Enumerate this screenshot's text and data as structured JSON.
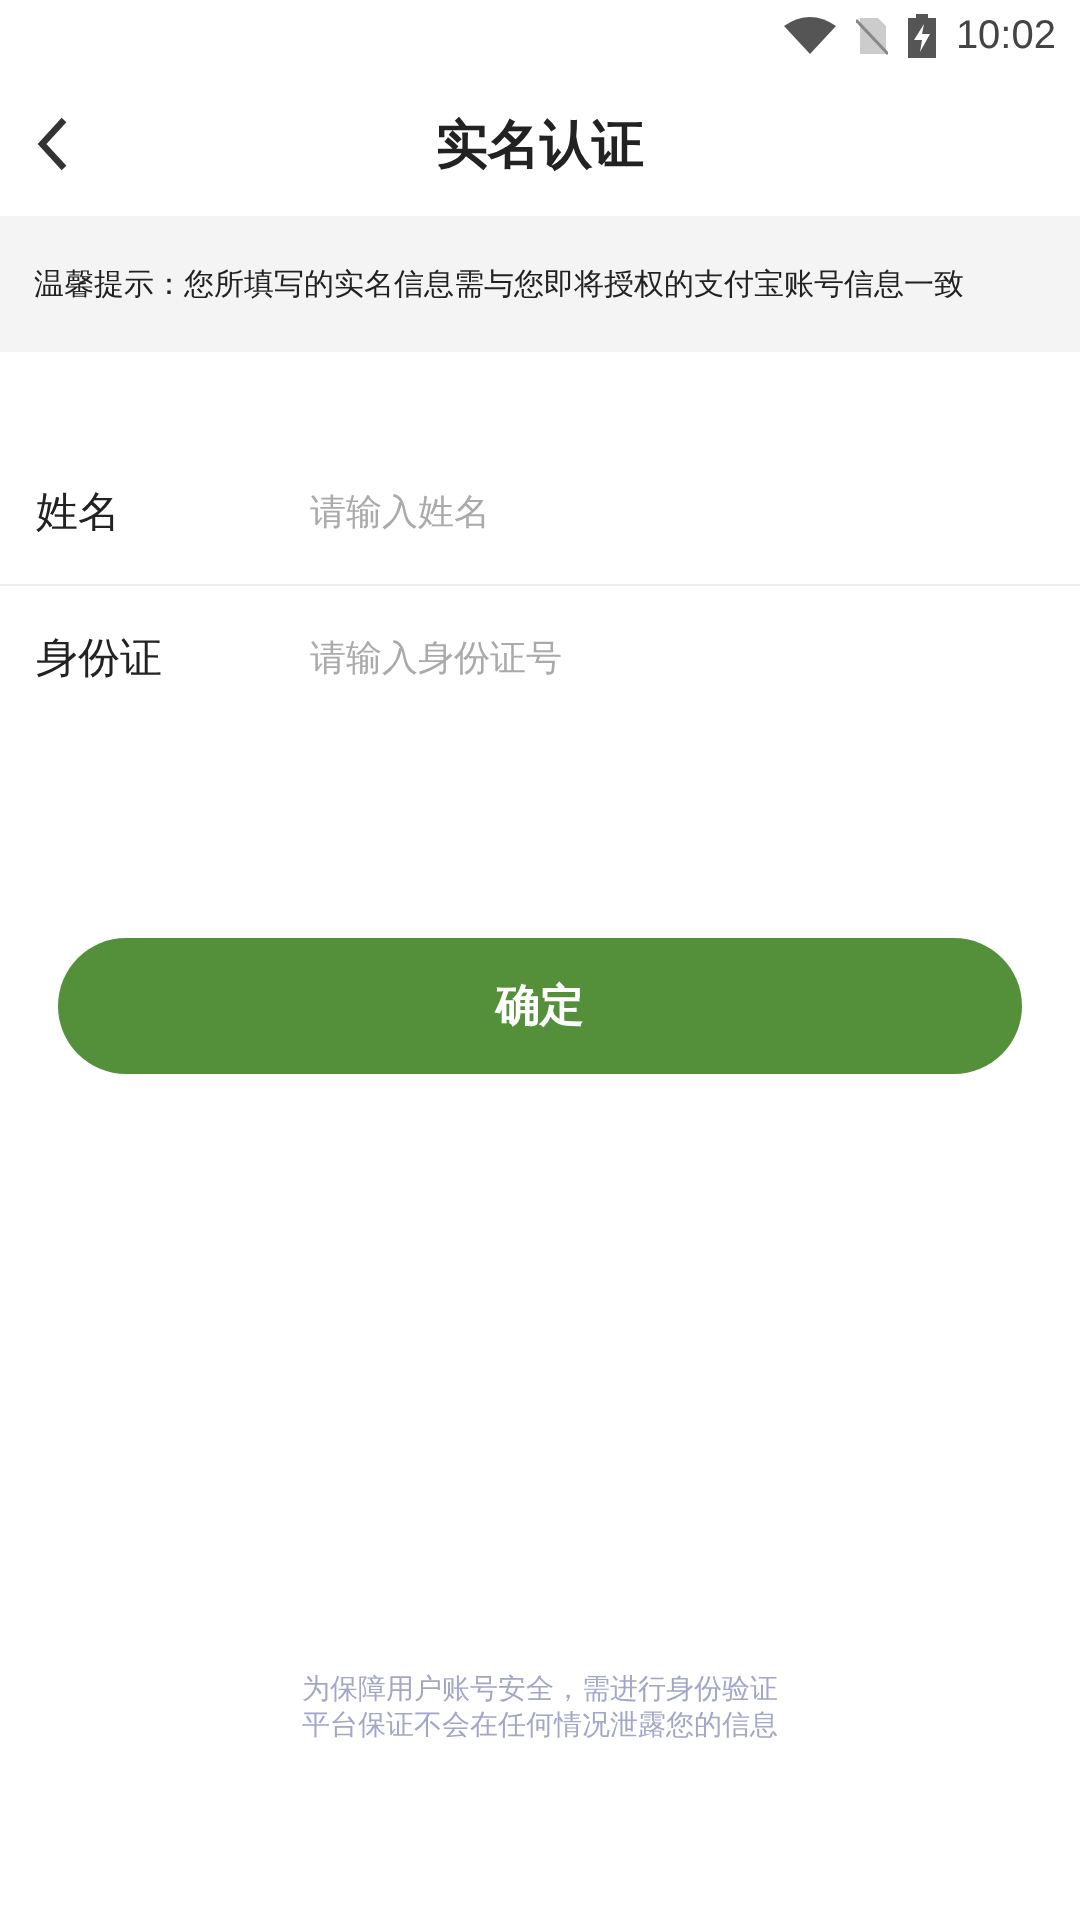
{
  "status_bar": {
    "time": "10:02"
  },
  "header": {
    "title": "实名认证"
  },
  "notice": "温馨提示：您所填写的实名信息需与您即将授权的支付宝账号信息一致",
  "fields": [
    {
      "label": "姓名",
      "placeholder": "请输入姓名"
    },
    {
      "label": "身份证",
      "placeholder": "请输入身份证号"
    }
  ],
  "confirm_button": "确定",
  "footer": [
    "为保障用户账号安全，需进行身份验证",
    "平台保证不会在任何情况泄露您的信息"
  ]
}
